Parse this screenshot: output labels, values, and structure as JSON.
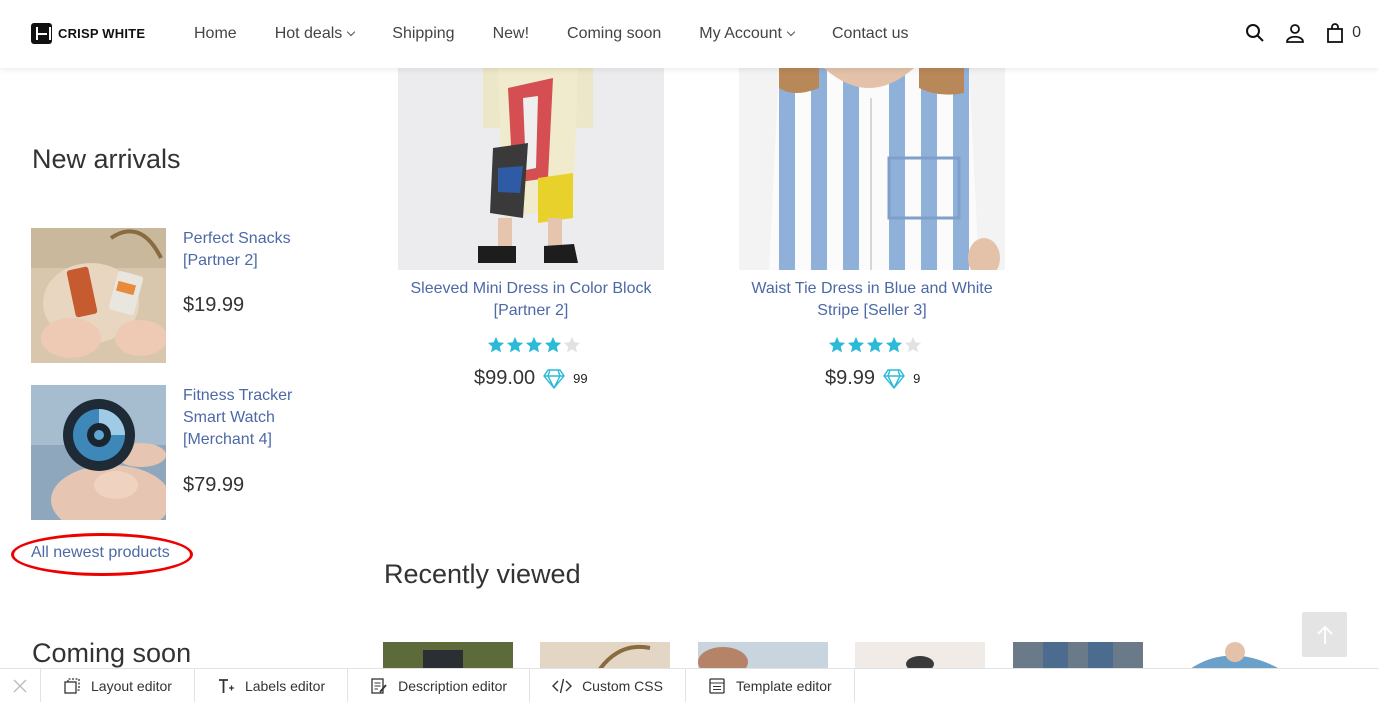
{
  "header": {
    "logo_text": "CRISP WHITE",
    "nav": [
      {
        "label": "Home"
      },
      {
        "label": "Hot deals"
      },
      {
        "label": "Shipping"
      },
      {
        "label": "New!"
      },
      {
        "label": "Coming soon"
      },
      {
        "label": "My Account"
      },
      {
        "label": "Contact us"
      }
    ],
    "cart_count": "0"
  },
  "new_arrivals": {
    "title": "New arrivals",
    "items": [
      {
        "name": "Perfect Snacks [Partner 2]",
        "price": "$19.99"
      },
      {
        "name": "Fitness Tracker Smart Watch [Merchant 4]",
        "price": "$79.99"
      }
    ],
    "all_link": "All newest products"
  },
  "products": [
    {
      "name": "Sleeved Mini Dress in Color Block [Partner 2]",
      "rating": 4,
      "price": "$99.00",
      "points": "99"
    },
    {
      "name": "Waist Tie Dress in Blue and White Stripe [Seller 3]",
      "rating": 4,
      "price": "$9.99",
      "points": "9"
    }
  ],
  "recently_viewed": {
    "title": "Recently viewed"
  },
  "coming_soon": {
    "title": "Coming soon"
  },
  "toolbar": {
    "items": [
      {
        "label": "Layout editor"
      },
      {
        "label": "Labels editor"
      },
      {
        "label": "Description editor"
      },
      {
        "label": "Custom CSS"
      },
      {
        "label": "Template editor"
      }
    ]
  },
  "colors": {
    "link": "#4c69a6",
    "star": "#2bbad8",
    "annotation": "#e00000"
  }
}
